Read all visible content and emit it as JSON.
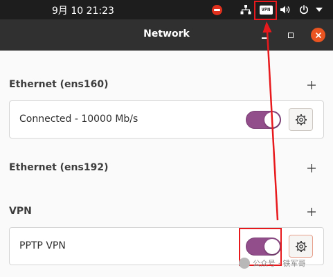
{
  "topbar": {
    "clock": "9月 10  21:23",
    "icons": [
      "do-not-disturb-icon",
      "network-wired-icon",
      "vpn-indicator-icon",
      "volume-icon",
      "power-icon",
      "chevron-down-icon"
    ],
    "vpn_badge": "VPN"
  },
  "header": {
    "title": "Network"
  },
  "sections": {
    "ethernet1": {
      "title": "Ethernet (ens160)",
      "status": "Connected - 10000 Mb/s",
      "enabled": true
    },
    "ethernet2": {
      "title": "Ethernet (ens192)"
    },
    "vpn": {
      "title": "VPN",
      "connection": "PPTP VPN",
      "enabled": true
    }
  },
  "watermark": {
    "text": "公众号 · 铁军哥"
  },
  "colors": {
    "topbar_bg": "#1d1d1d",
    "header_bg": "#303030",
    "accent_close": "#e95420",
    "toggle_on": "#924d8b",
    "annotation_red": "#e8191c"
  }
}
